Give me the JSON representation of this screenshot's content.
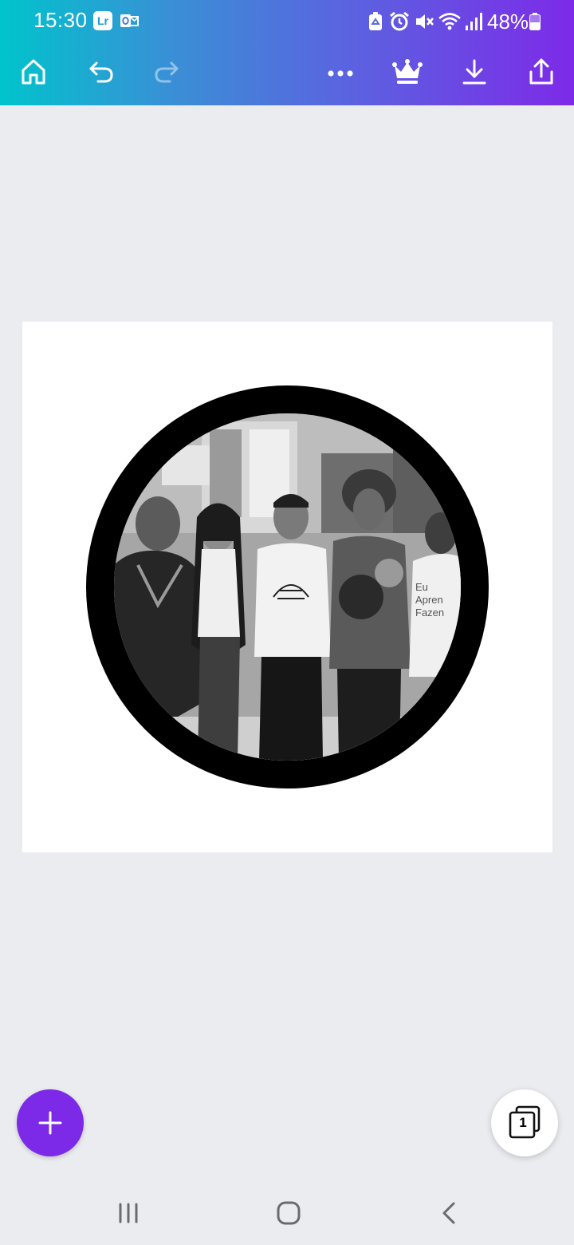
{
  "status_bar": {
    "time": "15:30",
    "lr_badge": "Lr",
    "battery_percent": "48%",
    "icons": [
      "lightroom-icon",
      "outlook-icon",
      "recycle-icon",
      "alarm-icon",
      "mute-icon",
      "wifi-icon",
      "signal-icon",
      "battery-icon"
    ]
  },
  "toolbar": {
    "icons": [
      "home-icon",
      "undo-icon",
      "redo-icon",
      "more-icon",
      "crown-icon",
      "download-icon",
      "share-icon"
    ],
    "redo_enabled": false
  },
  "canvas": {
    "page_background": "#ffffff",
    "frame_color": "#000000",
    "photo": "black-and-white group photo of five young people in a library"
  },
  "fab": {
    "add_icon": "plus-icon",
    "pages_count": "1"
  },
  "nav": {
    "icons": [
      "recents-icon",
      "home-circle-icon",
      "back-icon"
    ]
  },
  "colors": {
    "gradient_start": "#00c4cc",
    "gradient_end": "#7d2ae8",
    "accent": "#7d2ae8",
    "workspace": "#ebecf0"
  }
}
